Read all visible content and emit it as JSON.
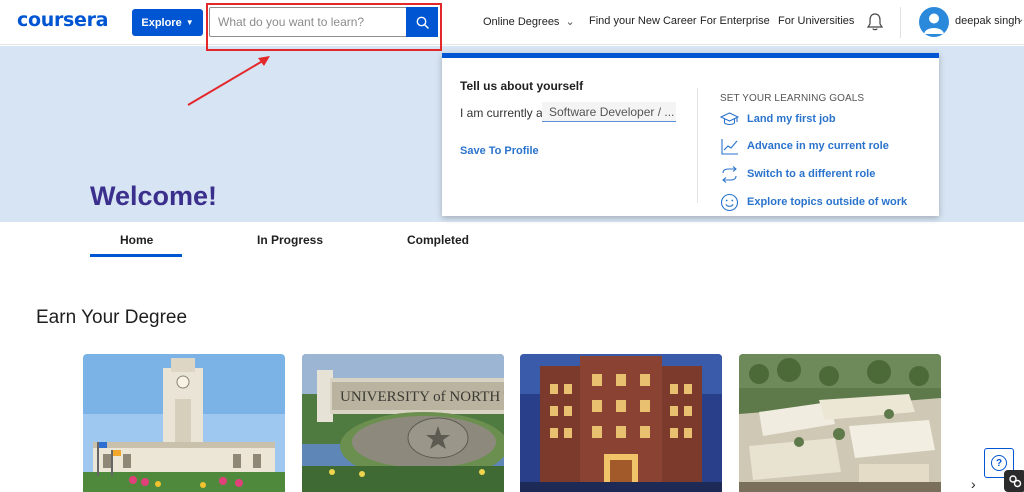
{
  "header": {
    "logo": "coursera",
    "explore_label": "Explore",
    "search": {
      "placeholder": "What do you want to learn?",
      "value": ""
    },
    "nav": [
      "Online Degrees",
      "Find your New Career",
      "For Enterprise",
      "For Universities"
    ],
    "user_name": "deepak singh"
  },
  "hero": {
    "welcome": "Welcome!"
  },
  "popover": {
    "title": "Tell us about yourself",
    "currently_label": "I am currently a",
    "currently_value": "Software Developer / ...",
    "save_label": "Save To Profile",
    "goals_heading": "SET YOUR LEARNING GOALS",
    "goals": [
      {
        "label": "Land my first job",
        "icon": "graduation-cap-icon"
      },
      {
        "label": "Advance in my current role",
        "icon": "trend-chart-icon"
      },
      {
        "label": "Switch to a different role",
        "icon": "switch-arrows-icon"
      },
      {
        "label": "Explore topics outside of work",
        "icon": "smiley-icon"
      }
    ]
  },
  "tabs": [
    {
      "label": "Home",
      "active": true
    },
    {
      "label": "In Progress",
      "active": false
    },
    {
      "label": "Completed",
      "active": false
    }
  ],
  "section_title": "Earn Your Degree",
  "cards": [
    {
      "name": "clock-tower-campus"
    },
    {
      "name": "university-of-north-texas",
      "sign_text": "UNIVERSITY of NORTH T"
    },
    {
      "name": "brick-building-night"
    },
    {
      "name": "aerial-campus"
    }
  ],
  "colors": {
    "brand": "#0056d2",
    "hero_bg": "#d7e4f3",
    "welcome": "#3a2f8c",
    "highlight": "#e3282c"
  }
}
